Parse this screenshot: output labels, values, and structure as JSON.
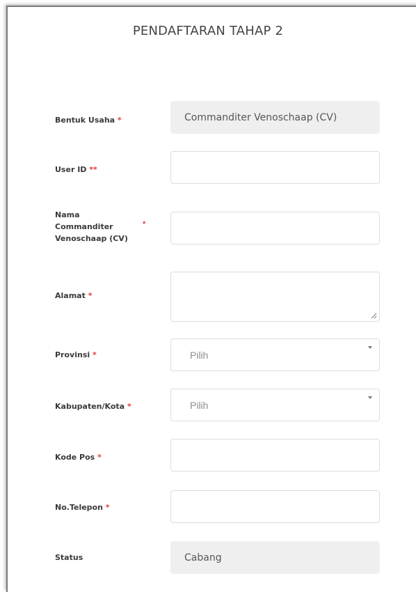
{
  "form": {
    "title": "PENDAFTARAN TAHAP 2",
    "fields": [
      {
        "label": "Bentuk Usaha",
        "required": "*",
        "value": "Commanditer Venoschaap (CV)"
      },
      {
        "label": "User ID",
        "required": "**",
        "value": ""
      },
      {
        "label": "Nama Commanditer Venoschaap (CV)",
        "label_lines": [
          "Nama",
          "Commanditer",
          "Venoschaap (CV)"
        ],
        "required": "*",
        "value": ""
      },
      {
        "label": "Alamat",
        "required": "*",
        "value": ""
      },
      {
        "label": "Provinsi",
        "required": "*",
        "value": "Pilih"
      },
      {
        "label": "Kabupaten/Kota",
        "required": "*",
        "value": "Pilih"
      },
      {
        "label": "Kode Pos",
        "required": "*",
        "value": ""
      },
      {
        "label": "No.Telepon",
        "required": "*",
        "value": ""
      },
      {
        "label": "Status",
        "required": "",
        "value": "Cabang"
      }
    ]
  },
  "icons": {
    "select_arrow": "chevron-down-icon",
    "textarea_resize": "resize-handle-icon"
  },
  "colors": {
    "required_marker": "#e23b3b",
    "readonly_bg": "#efefef",
    "border": "#dcdcdc",
    "title_text": "#444444"
  }
}
